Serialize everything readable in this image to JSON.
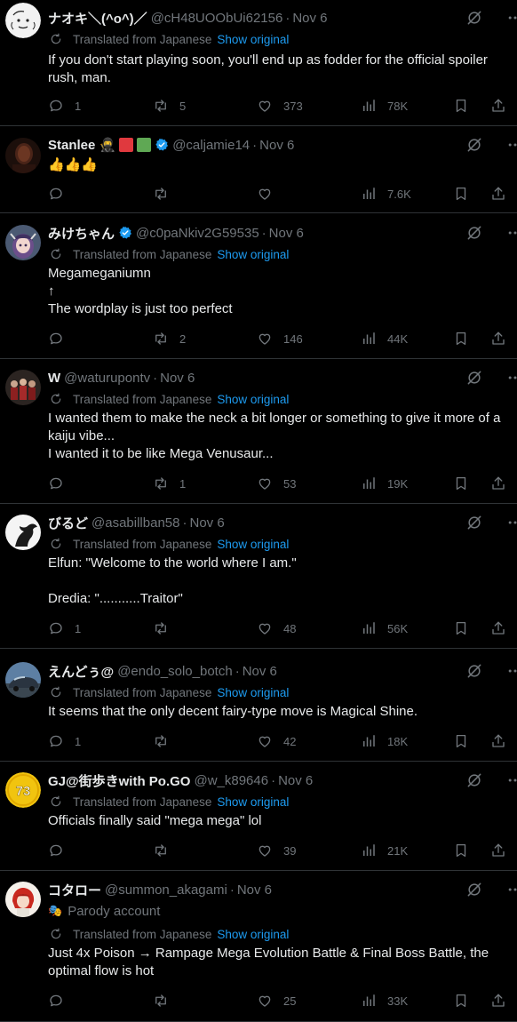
{
  "ui": {
    "translated_label": "Translated from Japanese",
    "show_original_label": "Show original",
    "dot": "·"
  },
  "colors": {
    "background": "#000000",
    "text": "#e7e9ea",
    "muted": "#71767b",
    "accent": "#1d9bf0",
    "divider": "#2f3336",
    "verified": "#1d9bf0"
  },
  "tweets": [
    {
      "name": "ナオキ＼(^o^)／",
      "handle": "@cH48UOObUi62156",
      "time": "Nov 6",
      "translated": true,
      "body": "If you don't start playing soon, you'll end up as fodder for the official spoiler rush, man.",
      "replies": "1",
      "reposts": "5",
      "likes": "373",
      "views": "78K",
      "avatar_icon": "sketch-face-avatar"
    },
    {
      "name": "Stanlee 🥷",
      "handle": "@caljamie14",
      "time": "Nov 6",
      "verified": true,
      "flag_colors": [
        "#e0393e",
        "#5fa854"
      ],
      "translated": false,
      "body": "👍👍👍",
      "replies": "",
      "reposts": "",
      "likes": "",
      "views": "7.6K",
      "avatar_icon": "dark-portrait-avatar"
    },
    {
      "name": "みけちゃん",
      "handle": "@c0paNkiv2G59535",
      "time": "Nov 6",
      "verified": true,
      "translated": true,
      "body": "Megameganiumn\n↑\nThe wordplay is just too perfect",
      "replies": "",
      "reposts": "2",
      "likes": "146",
      "views": "44K",
      "avatar_icon": "anime-girl-avatar"
    },
    {
      "name": "W",
      "handle": "@waturupontv",
      "time": "Nov 6",
      "translated": true,
      "body": "I wanted them to make the neck a bit longer or something to give it more of a kaiju vibe...\nI wanted it to be like Mega Venusaur...",
      "replies": "",
      "reposts": "1",
      "likes": "53",
      "views": "19K",
      "avatar_icon": "group-photo-avatar"
    },
    {
      "name": "びるど",
      "handle": "@asabillban58",
      "time": "Nov 6",
      "translated": true,
      "body": "Elfun: \"Welcome to the world where I am.\"\n\nDredia: \"...........Traitor\"",
      "replies": "1",
      "reposts": "",
      "likes": "48",
      "views": "56K",
      "avatar_icon": "horse-silhouette-avatar"
    },
    {
      "name": "えんどぅ@",
      "handle": "@endo_solo_botch",
      "time": "Nov 6",
      "translated": true,
      "body": "It seems that the only decent fairy-type move is Magical Shine.",
      "replies": "1",
      "reposts": "",
      "likes": "42",
      "views": "18K",
      "avatar_icon": "car-photo-avatar"
    },
    {
      "name": "GJ@街歩きwith Po.GO",
      "handle": "@w_k89646",
      "time": "Nov 6",
      "translated": true,
      "body": "Officials finally said \"mega mega\" lol",
      "replies": "",
      "reposts": "",
      "likes": "39",
      "views": "21K",
      "avatar_icon": "yellow-number-avatar",
      "avatar_text": "73"
    },
    {
      "name": "コタロー",
      "handle": "@summon_akagami",
      "time": "Nov 6",
      "parody": "Parody account",
      "translated": true,
      "body": "Just 4x Poison → Rampage Mega Evolution Battle & Final Boss Battle, the optimal flow is hot",
      "replies": "",
      "reposts": "",
      "likes": "25",
      "views": "33K",
      "avatar_icon": "red-hair-character-avatar"
    }
  ]
}
